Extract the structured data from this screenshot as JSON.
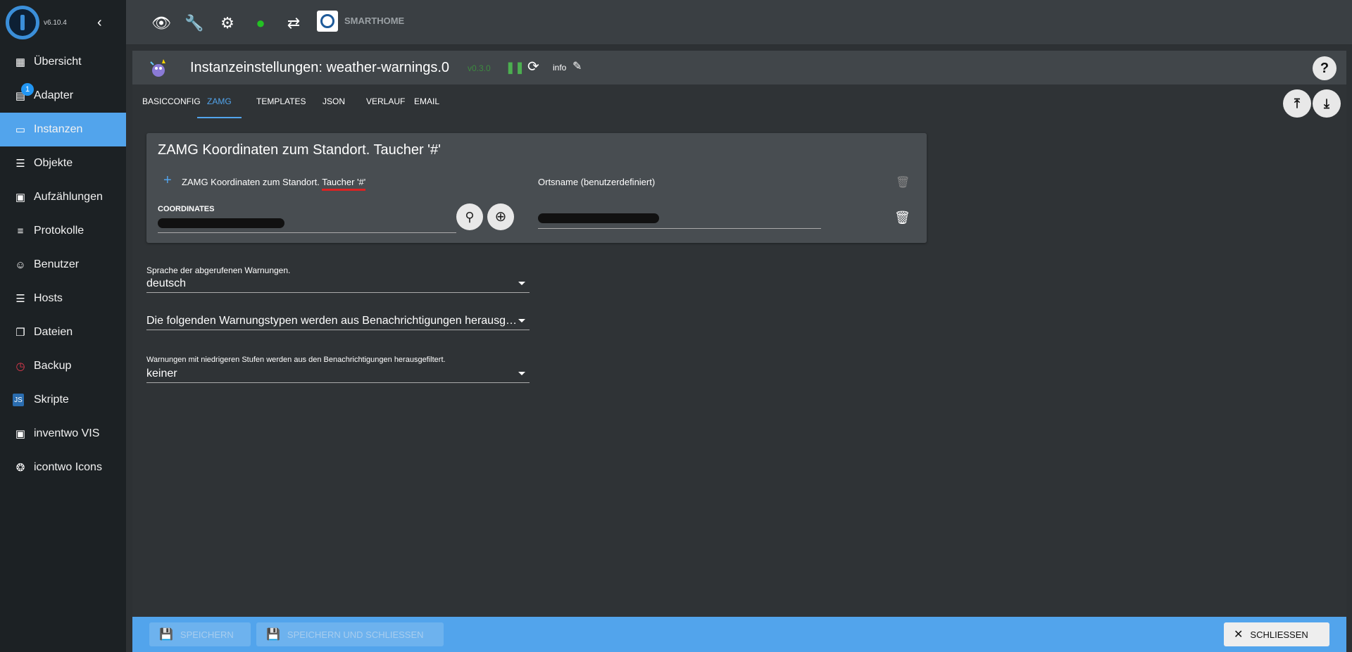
{
  "sidebar": {
    "version": "v6.10.4",
    "items": [
      {
        "label": "Übersicht",
        "icon": "apps-icon"
      },
      {
        "label": "Adapter",
        "icon": "store-icon",
        "badge": "1"
      },
      {
        "label": "Instanzen",
        "icon": "instances-icon"
      },
      {
        "label": "Objekte",
        "icon": "list-icon"
      },
      {
        "label": "Aufzählungen",
        "icon": "enums-icon"
      },
      {
        "label": "Protokolle",
        "icon": "logs-icon"
      },
      {
        "label": "Benutzer",
        "icon": "user-icon"
      },
      {
        "label": "Hosts",
        "icon": "hosts-icon"
      },
      {
        "label": "Dateien",
        "icon": "files-icon"
      },
      {
        "label": "Backup",
        "icon": "backup-icon"
      },
      {
        "label": "Skripte",
        "icon": "js-icon"
      },
      {
        "label": "inventwo VIS",
        "icon": "vis-icon"
      },
      {
        "label": "icontwo Icons",
        "icon": "icontwo-icon"
      }
    ],
    "active_index": 2
  },
  "topbar": {
    "brand": "SMARTHOME"
  },
  "dialog": {
    "title": "Instanzeinstellungen: weather-warnings.0",
    "version": "v0.3.0",
    "info": "info"
  },
  "tabs": [
    "BASICCONFIG",
    "ZAMG",
    "TEMPLATES",
    "JSON",
    "VERLAUF",
    "EMAIL"
  ],
  "active_tab": "ZAMG",
  "zamg": {
    "panel_title": "ZAMG Koordinaten zum Standort. Taucher '#'",
    "col1_header_prefix": "ZAMG Koordinaten zum Standort. ",
    "col1_header_underlined": "Taucher '#'",
    "col2_header": "Ortsname (benutzerdefiniert)",
    "coordinates_label": "COORDINATES"
  },
  "language": {
    "label": "Sprache der abgerufenen Warnungen.",
    "value": "deutsch"
  },
  "filter_types": {
    "value": "Die folgenden Warnungstypen werden aus Benachrichtigungen herausgefiltert."
  },
  "level_filter": {
    "label": "Warnungen mit niedrigeren Stufen werden aus den Benachrichtigungen herausgefiltert.",
    "value": "keiner"
  },
  "footer": {
    "save": "SPEICHERN",
    "save_close": "SPEICHERN UND SCHLIESSEN",
    "close": "SCHLIESSEN"
  },
  "colors": {
    "accent": "#52a4ec",
    "sidebar_bg": "#1c2124",
    "panel_bg": "#484d51",
    "running_green": "#4caf50"
  }
}
